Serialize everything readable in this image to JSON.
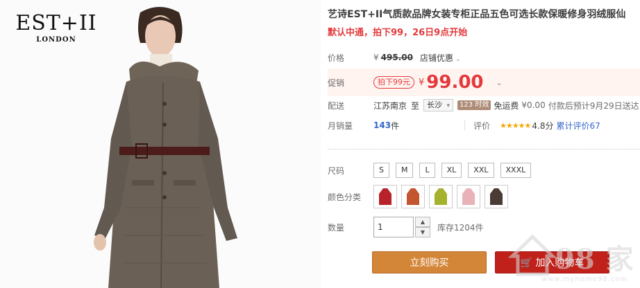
{
  "brand": {
    "name": "EST+II",
    "city": "LONDON"
  },
  "product": {
    "title": "艺诗EST+II气质款品牌女装专柜正品五色可选长款保暖修身羽绒服仙",
    "subtitle": "默认中通，拍下99，26日9点开始"
  },
  "price": {
    "label": "价格",
    "currency": "¥",
    "original": "495.00",
    "store_discount": "店铺优惠"
  },
  "promo": {
    "label": "促销",
    "tag": "拍下99元",
    "currency": "¥",
    "price": "99.00"
  },
  "delivery": {
    "label": "配送",
    "from": "江苏南京",
    "to_word": "至",
    "destination": "长沙",
    "time_badge": "123 时效",
    "free_label": "免运费",
    "fee": "¥0.00",
    "ship_note": "付款后预计9月29日送达"
  },
  "sales": {
    "label": "月销量",
    "count": "143",
    "unit": "件",
    "rating_label": "评价",
    "stars": "★★★★★",
    "score": "4.8分",
    "reviews": "累计评价67"
  },
  "sizes": {
    "label": "尺码",
    "options": [
      "S",
      "M",
      "L",
      "XL",
      "XXL",
      "XXXL"
    ]
  },
  "colors": {
    "label": "颜色分类",
    "swatch_colors": [
      "#b8232b",
      "#c3552f",
      "#a4b22e",
      "#e9b1b8",
      "#4a3b34"
    ]
  },
  "quantity": {
    "label": "数量",
    "value": "1",
    "stock": "库存1204件"
  },
  "actions": {
    "buy_now": "立刻购买",
    "add_to_cart": "加入购物车"
  },
  "watermark": {
    "text": "98 家",
    "url": "www.myhome98.com"
  }
}
